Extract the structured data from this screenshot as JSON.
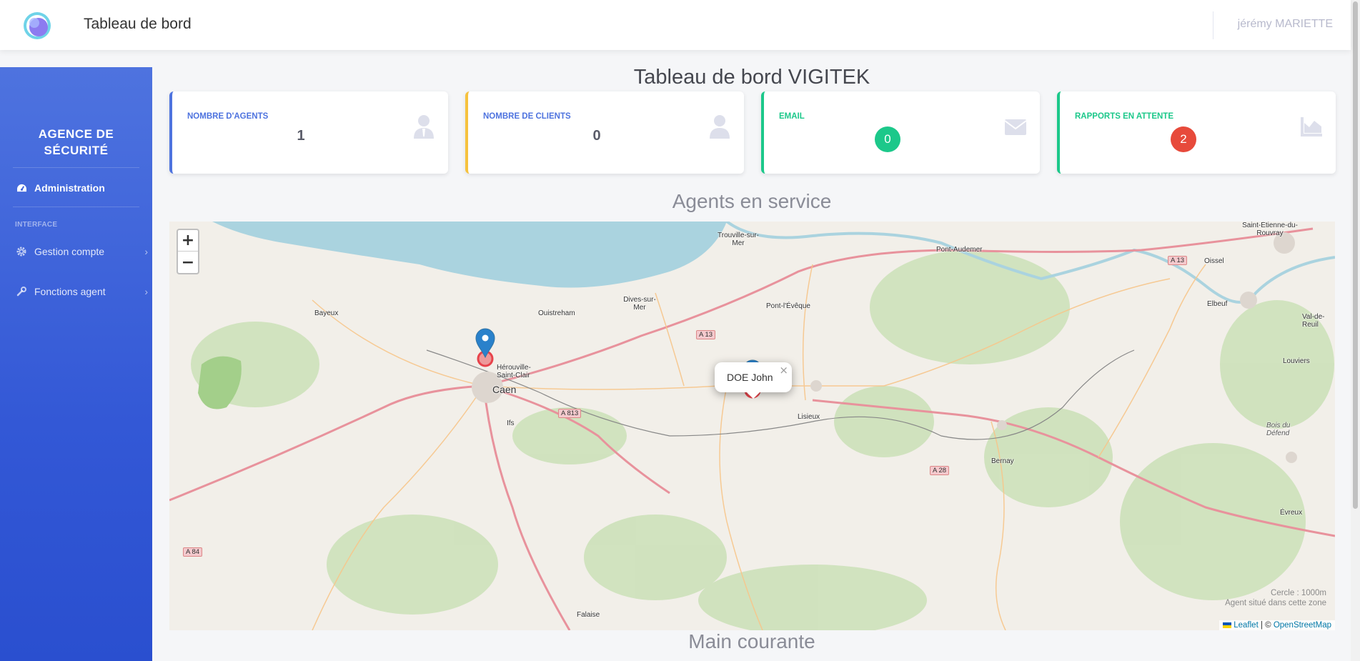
{
  "topbar": {
    "title": "Tableau de bord",
    "user_name": "jérémy MARIETTE"
  },
  "sidebar": {
    "brand_line1": "AGENCE DE",
    "brand_line2": "SÉCURITÉ",
    "active_item": "Administration",
    "heading": "INTERFACE",
    "items": [
      {
        "label": "Gestion compte",
        "icon": "gear-icon"
      },
      {
        "label": "Fonctions agent",
        "icon": "wrench-icon"
      }
    ]
  },
  "main": {
    "title": "Tableau de bord VIGITEK",
    "cards": [
      {
        "label": "NOMBRE D'AGENTS",
        "value": "1",
        "color": "#4e73df",
        "icon": "user-tie-icon"
      },
      {
        "label": "NOMBRE DE CLIENTS",
        "value": "0",
        "color": "#f6c23e",
        "label_color": "#4e73df",
        "icon": "user-icon"
      },
      {
        "label": "EMAIL",
        "value": "0",
        "color": "#1cc88a",
        "icon": "envelope-icon"
      },
      {
        "label": "RAPPORTS EN ATTENTE",
        "value": "2",
        "color": "#1cc88a",
        "badge_color": "#e74a3b",
        "icon": "chart-area-icon"
      }
    ],
    "map_section_title": "Agents en service",
    "next_section_title": "Main courante"
  },
  "map": {
    "zoom_in": "+",
    "zoom_out": "−",
    "popup_text": "DOE John",
    "popup_close": "×",
    "legend_line1": "Cercle : 1000m",
    "legend_line2": "Agent situé dans cette zone",
    "attribution_leaflet": "Leaflet",
    "attribution_sep": " | © ",
    "attribution_osm": "OpenStreetMap",
    "places": [
      "Trouville-sur-Mer",
      "Pont-Audemer",
      "Saint-Étienne-du-Rouvray",
      "Oissel",
      "Bayeux",
      "Ouistreham",
      "Dives-sur-Mer",
      "Pont-l'Évêque",
      "Elbeuf",
      "Val-de-Reuil",
      "Louviers",
      "Hérouville-Saint-Clair",
      "Caen",
      "Ifs",
      "Lisieux",
      "Bernay",
      "Bois du Défend",
      "Évreux",
      "Falaise"
    ],
    "roads": [
      "A 13",
      "A 13",
      "A 813",
      "A 28",
      "A 84"
    ]
  }
}
